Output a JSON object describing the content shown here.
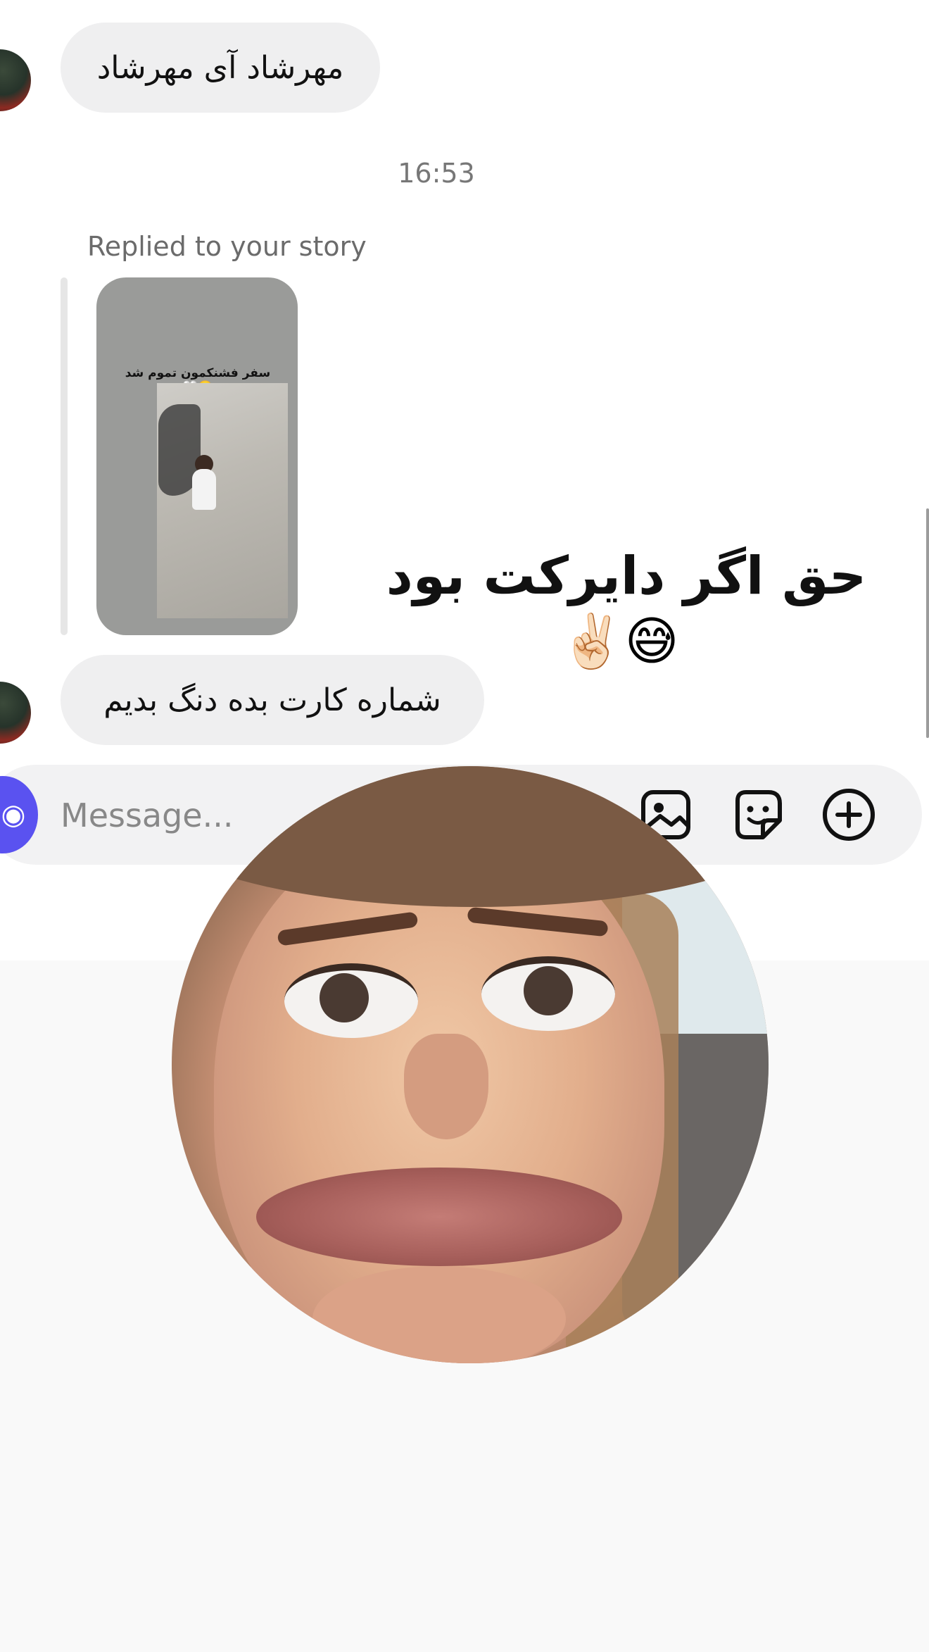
{
  "messages": {
    "first": "مهرشاد آی مهرشاد",
    "timestamp": "16:53",
    "replied_label": "Replied to your story",
    "story_caption": "سفر فشنکمون تموم شد🥹🤍",
    "reply_sticker_text": "حق اگر دایرکت بود",
    "reply_sticker_emoji": "✌🏻😅",
    "second": "شماره کارت بده دنگ بدیم"
  },
  "composer": {
    "placeholder": "Message...",
    "icons": [
      "camera-icon",
      "image-icon",
      "sticker-icon",
      "plus-circle-icon"
    ]
  },
  "colors": {
    "accent": "#5a52f0",
    "bubble": "#efeff0",
    "composer_bg": "#f2f2f3"
  }
}
